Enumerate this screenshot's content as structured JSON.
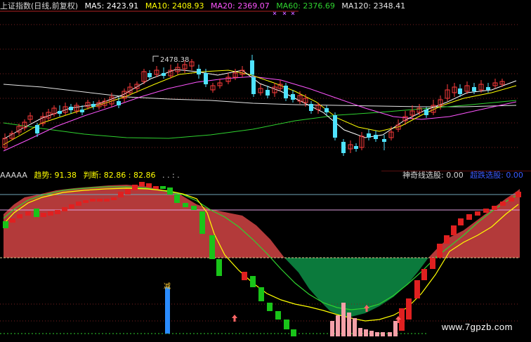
{
  "main_header": {
    "title": "上证指数(日线,前复权)",
    "ma5": "MA5: 2423.91",
    "ma10": "MA10: 2408.93",
    "ma20": "MA20: 2369.07",
    "ma60": "MA60: 2376.69",
    "ma120": "MA120: 2348.41"
  },
  "main_chart": {
    "peak_label": "2478.38"
  },
  "indicator_header": {
    "name": "AAAAA",
    "trend": "趋势: 91.38",
    "judge": "判断: 82.86 : 82.86",
    "dash": ". . : .",
    "right_a": "神奇线选股: 0.00",
    "right_b": "超跌选股: 0.00"
  },
  "indicator_chart": {
    "marker_label": "减"
  },
  "watermark": "www.7gpzb.com",
  "colors": {
    "up": "#ff3b3b",
    "down": "#4fe3ff",
    "ma5": "#ffffff",
    "ma10": "#ffff00",
    "ma20": "#ff55ff",
    "ma60": "#2fd22f",
    "ma120": "#e6e6e6",
    "red_area": "#b33a3a",
    "green_area": "#0b7a3c"
  }
}
